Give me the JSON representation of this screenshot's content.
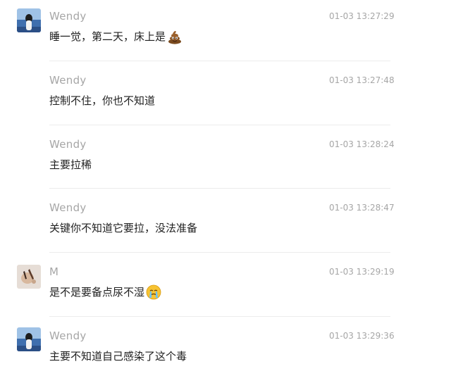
{
  "messages": [
    {
      "sender": "Wendy",
      "time": "01-03 13:27:29",
      "text": "睡一觉，第二天，床上是",
      "emoji": "pile-of-poo-icon",
      "avatar": "wendy-avatar"
    },
    {
      "sender": "Wendy",
      "time": "01-03 13:27:48",
      "text": "控制不住，你也不知道"
    },
    {
      "sender": "Wendy",
      "time": "01-03 13:28:24",
      "text": "主要拉稀"
    },
    {
      "sender": "Wendy",
      "time": "01-03 13:28:47",
      "text": "关键你不知道它要拉，没法准备"
    },
    {
      "sender": "M",
      "time": "01-03 13:29:19",
      "text": "是不是要备点尿不湿",
      "emoji": "crying-face-icon",
      "avatar": "m-avatar"
    },
    {
      "sender": "Wendy",
      "time": "01-03 13:29:36",
      "text": "主要不知道自己感染了这个毒",
      "avatar": "wendy-avatar"
    }
  ],
  "colors": {
    "meta_text": "#a6a6a6",
    "body_text": "#1f1f1f",
    "divider": "#ececec",
    "background": "#ffffff"
  }
}
